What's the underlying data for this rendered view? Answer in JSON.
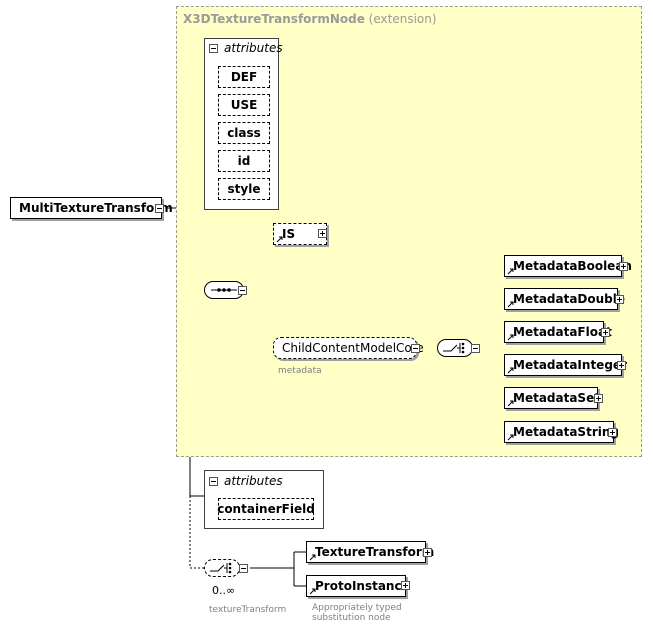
{
  "root_element": "MultiTextureTransform",
  "extension": {
    "base_type": "X3DTextureTransformNode",
    "qualifier": "(extension)",
    "attributes_label": "attributes",
    "attributes": [
      "DEF",
      "USE",
      "class",
      "id",
      "style"
    ],
    "sequence_children": [
      {
        "name": "IS"
      },
      {
        "name": "ChildContentModelCore",
        "note": "metadata"
      }
    ],
    "choice_children": [
      "MetadataBoolean",
      "MetadataDouble",
      "MetadataFloat",
      "MetadataInteger",
      "MetadataSet",
      "MetadataString"
    ]
  },
  "own_attributes": {
    "label": "attributes",
    "items": [
      "containerField"
    ]
  },
  "texture_choice": {
    "cardinality": "0..∞",
    "note": "textureTransform",
    "children": [
      "TextureTransform",
      "ProtoInstance"
    ],
    "substitution_note": "Appropriately typed substitution node"
  }
}
